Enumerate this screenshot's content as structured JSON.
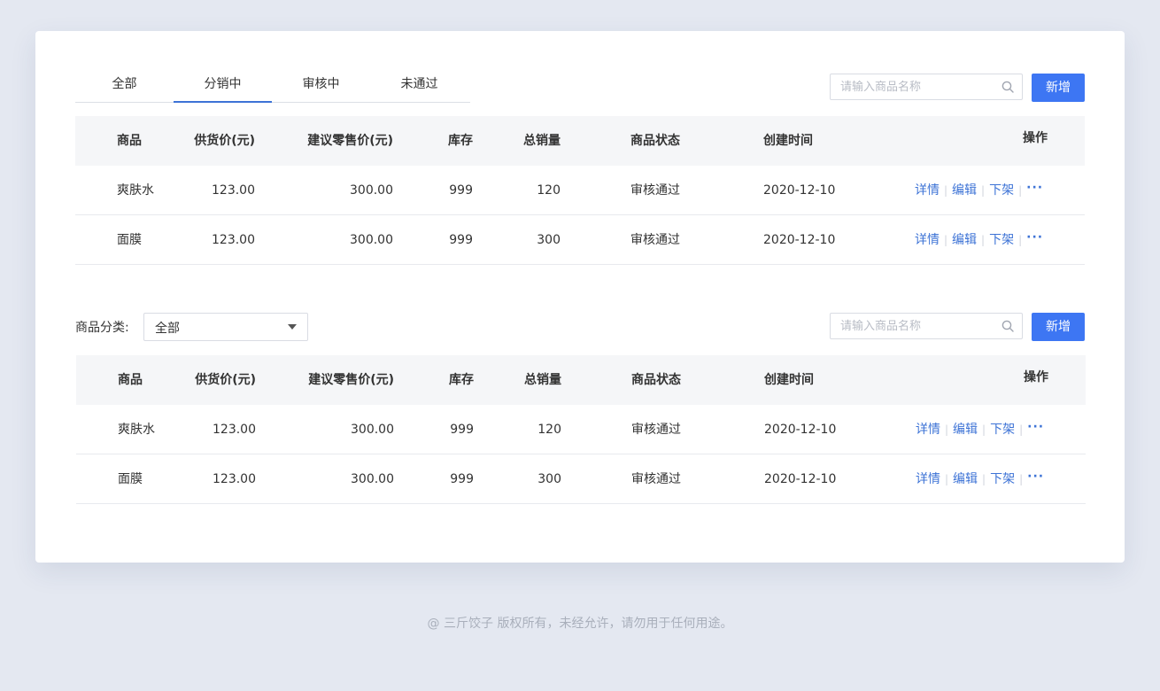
{
  "tabs": [
    {
      "label": "全部"
    },
    {
      "label": "分销中"
    },
    {
      "label": "审核中"
    },
    {
      "label": "未通过"
    }
  ],
  "active_tab": "分销中",
  "search": {
    "placeholder": "请输入商品名称"
  },
  "add_button": "新增",
  "category": {
    "label": "商品分类:",
    "selected": "全部"
  },
  "columns": {
    "name": "商品",
    "supply_price": "供货价(元)",
    "retail_price": "建议零售价(元)",
    "stock": "库存",
    "sold": "总销量",
    "status": "商品状态",
    "created": "创建时间",
    "ops": "操作"
  },
  "ops_labels": {
    "detail": "详情",
    "edit": "编辑",
    "offshelf": "下架",
    "more": "···"
  },
  "table1": {
    "rows": [
      {
        "name": "爽肤水",
        "supply_price": "123.00",
        "retail_price": "300.00",
        "stock": "999",
        "sold": "120",
        "status": "审核通过",
        "created": "2020-12-10"
      },
      {
        "name": "面膜",
        "supply_price": "123.00",
        "retail_price": "300.00",
        "stock": "999",
        "sold": "300",
        "status": "审核通过",
        "created": "2020-12-10"
      }
    ]
  },
  "table2": {
    "rows": [
      {
        "name": "爽肤水",
        "supply_price": "123.00",
        "retail_price": "300.00",
        "stock": "999",
        "sold": "120",
        "status": "审核通过",
        "created": "2020-12-10"
      },
      {
        "name": "面膜",
        "supply_price": "123.00",
        "retail_price": "300.00",
        "stock": "999",
        "sold": "300",
        "status": "审核通过",
        "created": "2020-12-10"
      }
    ]
  },
  "footer": "@ 三斤饺子  版权所有，未经允许，请勿用于任何用途。",
  "colors": {
    "accent": "#3d76f3",
    "link": "#3d73d6",
    "background": "#e4e8f1"
  }
}
